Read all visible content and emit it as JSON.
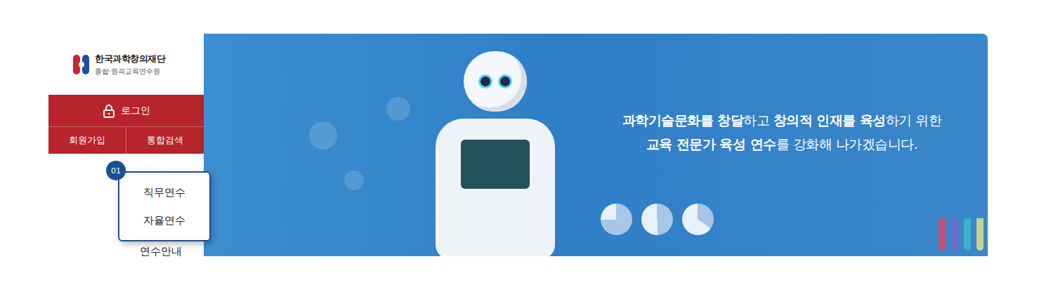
{
  "logo": {
    "title": "한국과학창의재단",
    "subtitle": "종합·원격교육연수원"
  },
  "auth": {
    "login": "로그인",
    "links": [
      "회원가입",
      "통합검색"
    ]
  },
  "nav": {
    "groups": [
      {
        "badge": "01",
        "expanded": true,
        "items": [
          {
            "label": "직무연수"
          },
          {
            "label": "자율연수"
          }
        ]
      }
    ],
    "items": [
      {
        "label": "연수안내"
      }
    ]
  },
  "banner": {
    "lines": [
      [
        {
          "text": "과학기술문화를 창달",
          "bold": true
        },
        {
          "text": "하고 ",
          "bold": false
        },
        {
          "text": "창의적 인재를 육성",
          "bold": true
        },
        {
          "text": "하기 위한",
          "bold": false
        }
      ],
      [
        {
          "text": "교육 전문가 육성 연수",
          "bold": true
        },
        {
          "text": "를 강화해 나가겠습니다.",
          "bold": false
        }
      ]
    ]
  }
}
